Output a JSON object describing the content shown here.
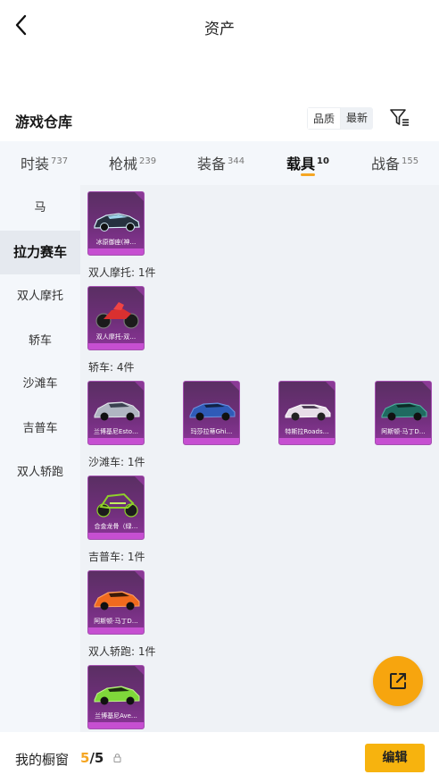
{
  "header": {
    "title": "资产"
  },
  "warehouse": {
    "title": "游戏仓库",
    "sort_quality": "品质",
    "sort_latest": "最新"
  },
  "tabs": [
    {
      "label": "时装",
      "count": "737"
    },
    {
      "label": "枪械",
      "count": "239"
    },
    {
      "label": "装备",
      "count": "344"
    },
    {
      "label": "载具",
      "count": "10",
      "active": true
    },
    {
      "label": "战备",
      "count": "155"
    }
  ],
  "sidebar": {
    "items": [
      {
        "label": "马"
      },
      {
        "label": "拉力赛车",
        "active": true
      },
      {
        "label": "双人摩托"
      },
      {
        "label": "轿车"
      },
      {
        "label": "沙滩车"
      },
      {
        "label": "吉普车"
      },
      {
        "label": "双人轿跑"
      }
    ]
  },
  "groups": {
    "rally": {
      "items": [
        {
          "name": "冰原御座(神…",
          "color": "#c8e6f2"
        }
      ]
    },
    "moto": {
      "label": "双人摩托: 1件",
      "items": [
        {
          "name": "双人摩托-双…",
          "color": "#d93030"
        }
      ]
    },
    "sedan": {
      "label": "轿车: 4件",
      "items": [
        {
          "name": "兰博基尼Esto…",
          "color": "#b0b6c2"
        },
        {
          "name": "玛莎拉蒂Ghi…",
          "color": "#2f5bb8"
        },
        {
          "name": "特斯拉Roads…",
          "color": "#e7dde8"
        },
        {
          "name": "阿斯顿·马丁D…",
          "color": "#1f6a60"
        }
      ]
    },
    "beach": {
      "label": "沙滩车: 1件",
      "items": [
        {
          "name": "合金龙骨（绿…",
          "color": "#8fd12a"
        }
      ]
    },
    "jeep": {
      "label": "吉普车: 1件",
      "items": [
        {
          "name": "阿斯顿·马丁D…",
          "color": "#f06a1e"
        }
      ]
    },
    "coupe": {
      "label": "双人轿跑: 1件",
      "items": [
        {
          "name": "兰博基尼Ave…",
          "color": "#7fd83a"
        }
      ]
    }
  },
  "bottom": {
    "label": "我的橱窗",
    "count_current": "5",
    "count_total": "/5",
    "edit_label": "编辑"
  },
  "icons": {
    "back": "chevron-left-icon",
    "filter": "filter-icon",
    "share": "share-external-icon",
    "lock": "lock-icon"
  },
  "colors": {
    "accent": "#f5a623",
    "card_purple": "#6f2f7a",
    "card_band": "#c64fd1"
  }
}
